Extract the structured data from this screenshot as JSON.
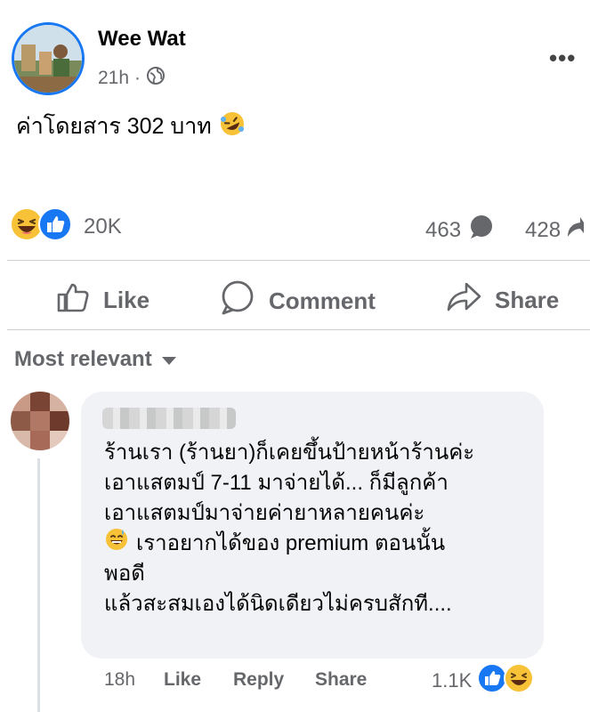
{
  "post": {
    "author": "Wee Wat",
    "time": "21h",
    "separator": "·",
    "audience_icon": "globe-icon",
    "text": "ค่าโดยสาร 302 บาท",
    "text_emoji": "rolling-on-floor-laughing-icon"
  },
  "stats": {
    "reaction_icons": [
      "haha-icon",
      "like-icon"
    ],
    "reactions": "20K",
    "comments": "463",
    "shares": "428"
  },
  "actions": {
    "like": "Like",
    "comment": "Comment",
    "share": "Share"
  },
  "sort": {
    "label": "Most relevant"
  },
  "comment": {
    "lines": [
      "ร้านเรา (ร้านยา)ก็เคยขึ้นป้ายหน้าร้านค่ะ",
      "เอาแสตมป์ 7-11 มาจ่ายได้... ก็มีลูกค้า",
      "เอาแสตมป์มาจ่ายค่ายาหลายคนค่ะ",
      "เราอยากได้ของ premium ตอนนั้น",
      "พอดี",
      "แล้วสะสมเองได้นิดเดียวไม่ครบสักที...."
    ],
    "time": "18h",
    "like_label": "Like",
    "reply_label": "Reply",
    "share_label": "Share",
    "reaction_count": "1.1K"
  },
  "colors": {
    "accent": "#1877f2",
    "muted_text": "#65676b",
    "bubble": "#f0f2f5"
  }
}
